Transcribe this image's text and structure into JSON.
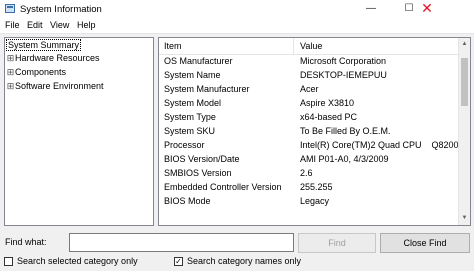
{
  "window": {
    "title": "System Information",
    "controls": {
      "minimize": "—",
      "maximize": "☐",
      "close": "✕"
    }
  },
  "menu": [
    "File",
    "Edit",
    "View",
    "Help"
  ],
  "tree": [
    {
      "label": "System Summary",
      "expander": "",
      "selected": true
    },
    {
      "label": "Hardware Resources",
      "expander": "⊞"
    },
    {
      "label": "Components",
      "expander": "⊞"
    },
    {
      "label": "Software Environment",
      "expander": "⊞"
    }
  ],
  "list": {
    "headers": {
      "item": "Item",
      "value": "Value"
    },
    "rows": [
      {
        "item": "OS Manufacturer",
        "value": "Microsoft Corporation"
      },
      {
        "item": "System Name",
        "value": "DESKTOP-IEMEPUU"
      },
      {
        "item": "System Manufacturer",
        "value": "Acer"
      },
      {
        "item": "System Model",
        "value": "Aspire X3810"
      },
      {
        "item": "System Type",
        "value": "x64-based PC"
      },
      {
        "item": "System SKU",
        "value": "To Be Filled By O.E.M."
      },
      {
        "item": "Processor",
        "value": "Intel(R) Core(TM)2 Quad CPU    Q8200"
      },
      {
        "item": "BIOS Version/Date",
        "value": "AMI P01-A0, 4/3/2009"
      },
      {
        "item": "SMBIOS Version",
        "value": "2.6"
      },
      {
        "item": "Embedded Controller Version",
        "value": "255.255"
      },
      {
        "item": "BIOS Mode",
        "value": "Legacy"
      }
    ]
  },
  "find": {
    "label": "Find what:",
    "value": "",
    "find_button": "Find",
    "close_find_button": "Close Find",
    "search_selected_label": "Search selected category only",
    "search_selected_checked": false,
    "search_names_label": "Search category names only",
    "search_names_checked": true
  }
}
